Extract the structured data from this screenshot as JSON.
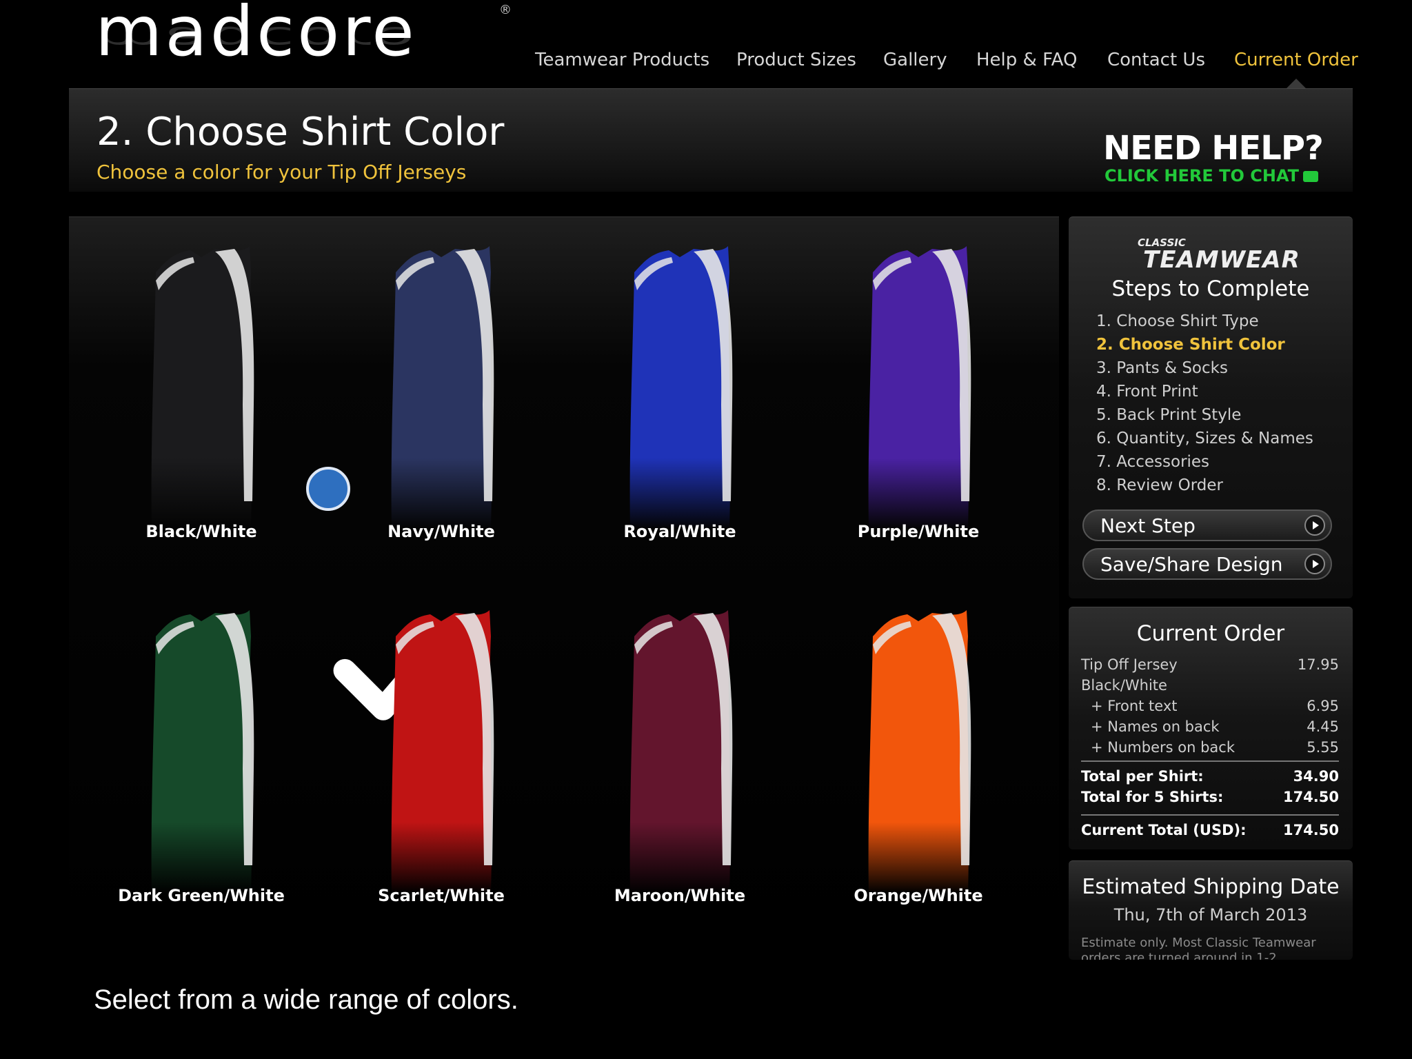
{
  "brand": {
    "name": "madcore",
    "reg": "®"
  },
  "nav": {
    "items": [
      "Teamwear Products",
      "Product Sizes",
      "Gallery",
      "Help & FAQ",
      "Contact Us",
      "Current Order"
    ],
    "active": "Current Order"
  },
  "header": {
    "title": "2. Choose Shirt Color",
    "subtitle": "Choose a color for your Tip Off Jerseys",
    "help_title": "NEED HELP?",
    "help_chat": "CLICK HERE TO CHAT"
  },
  "swatches": [
    {
      "label": "Black/White",
      "color": "#1b1b1d",
      "selected": true
    },
    {
      "label": "Navy/White",
      "color": "#2b3561"
    },
    {
      "label": "Royal/White",
      "color": "#1f33b8"
    },
    {
      "label": "Purple/White",
      "color": "#4a22a3"
    },
    {
      "label": "Dark Green/White",
      "color": "#164a2a"
    },
    {
      "label": "Scarlet/White",
      "color": "#c01414"
    },
    {
      "label": "Maroon/White",
      "color": "#63152d"
    },
    {
      "label": "Orange/White",
      "color": "#f2560c"
    }
  ],
  "sidebar": {
    "brand_small": "CLASSIC",
    "brand_big": "TEAMWEAR",
    "steps_title": "Steps to Complete",
    "steps": [
      "1. Choose Shirt Type",
      "2. Choose Shirt Color",
      "3. Pants & Socks",
      "4. Front Print",
      "5. Back Print Style",
      "6. Quantity, Sizes & Names",
      "7. Accessories",
      "8. Review Order"
    ],
    "current_step": 1,
    "next_label": "Next Step",
    "save_label": "Save/Share Design"
  },
  "order": {
    "title": "Current Order",
    "item_name": "Tip Off Jersey",
    "item_price": "17.95",
    "item_color": "Black/White",
    "extras": [
      {
        "label": "+ Front text",
        "price": "6.95"
      },
      {
        "label": "+ Names on back",
        "price": "4.45"
      },
      {
        "label": "+ Numbers on back",
        "price": "5.55"
      }
    ],
    "total_per_shirt_label": "Total per Shirt:",
    "total_per_shirt": "34.90",
    "total_shirts_label": "Total for 5 Shirts:",
    "total_shirts": "174.50",
    "current_total_label": "Current Total (USD):",
    "current_total": "174.50"
  },
  "shipping": {
    "title": "Estimated Shipping Date",
    "date": "Thu, 7th of March 2013",
    "note": "Estimate only. Most Classic Teamwear orders are turned around in 1-2"
  },
  "caption": "Select from a wide range of colors.",
  "colors": {
    "accent_yellow": "#f0c33c",
    "chat_green": "#22c93a",
    "check_blue": "#2e6fbf"
  }
}
